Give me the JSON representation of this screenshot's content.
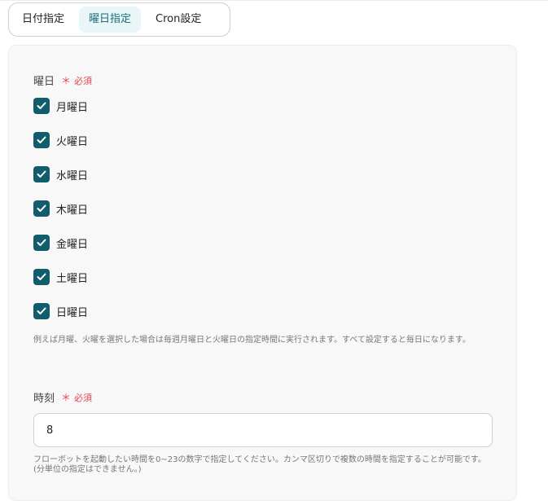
{
  "tabs": [
    {
      "label": "日付指定"
    },
    {
      "label": "曜日指定"
    },
    {
      "label": "Cron設定"
    }
  ],
  "weekday_field": {
    "label": "曜日",
    "required": "必須",
    "required_star": "＊",
    "days": [
      {
        "label": "月曜日",
        "checked": true
      },
      {
        "label": "火曜日",
        "checked": true
      },
      {
        "label": "水曜日",
        "checked": true
      },
      {
        "label": "木曜日",
        "checked": true
      },
      {
        "label": "金曜日",
        "checked": true
      },
      {
        "label": "土曜日",
        "checked": true
      },
      {
        "label": "日曜日",
        "checked": true
      }
    ],
    "hint": "例えば月曜、火曜を選択した場合は毎週月曜日と火曜日の指定時間に実行されます。すべて設定すると毎日になります。"
  },
  "time_field": {
    "label": "時刻",
    "required": "必須",
    "required_star": "＊",
    "value": "8",
    "hint": "フローボットを起動したい時間を0~23の数字で指定してください。カンマ区切りで複数の時間を指定することが可能です。(分単位の指定はできません。)"
  },
  "colors": {
    "accent": "#125d6b",
    "active_tab_bg": "#e8f6f7",
    "required": "#e0454f"
  }
}
